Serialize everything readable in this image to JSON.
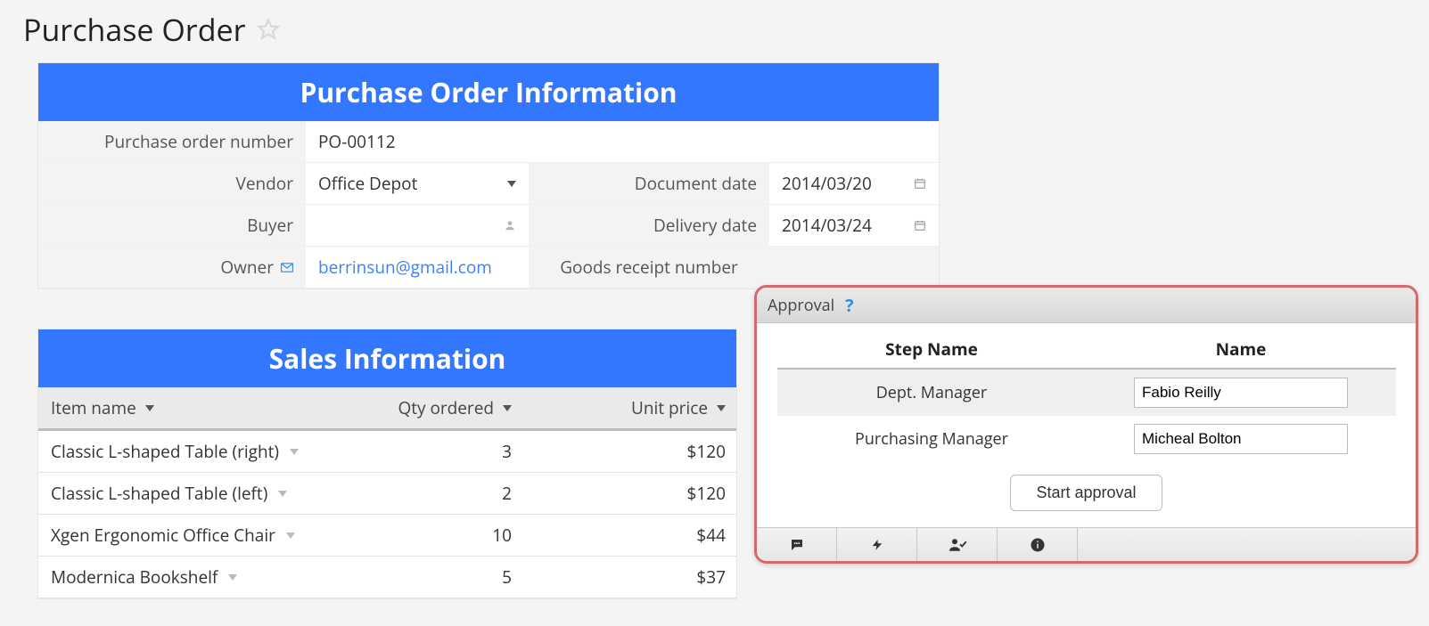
{
  "page": {
    "title": "Purchase Order"
  },
  "info_header": "Purchase Order Information",
  "info": {
    "po_number_label": "Purchase order number",
    "po_number": "PO-00112",
    "vendor_label": "Vendor",
    "vendor": "Office Depot",
    "doc_date_label": "Document date",
    "doc_date": "2014/03/20",
    "buyer_label": "Buyer",
    "buyer": "",
    "delivery_date_label": "Delivery date",
    "delivery_date": "2014/03/24",
    "owner_label": "Owner",
    "owner": "berrinsun@gmail.com",
    "goods_receipt_label": "Goods receipt number",
    "goods_receipt": ""
  },
  "sales_header": "Sales Information",
  "sales_columns": {
    "item": "Item name",
    "qty": "Qty ordered",
    "price": "Unit price"
  },
  "sales_rows": [
    {
      "item": "Classic L-shaped Table (right)",
      "qty": "3",
      "price": "$120"
    },
    {
      "item": "Classic L-shaped Table (left)",
      "qty": "2",
      "price": "$120"
    },
    {
      "item": "Xgen Ergonomic Office Chair",
      "qty": "10",
      "price": "$44"
    },
    {
      "item": "Modernica Bookshelf",
      "qty": "5",
      "price": "$37"
    }
  ],
  "approval": {
    "title": "Approval",
    "columns": {
      "step": "Step Name",
      "name": "Name"
    },
    "rows": [
      {
        "step": "Dept. Manager",
        "name": "Fabio Reilly"
      },
      {
        "step": "Purchasing Manager",
        "name": "Micheal Bolton"
      }
    ],
    "start_button": "Start approval"
  }
}
